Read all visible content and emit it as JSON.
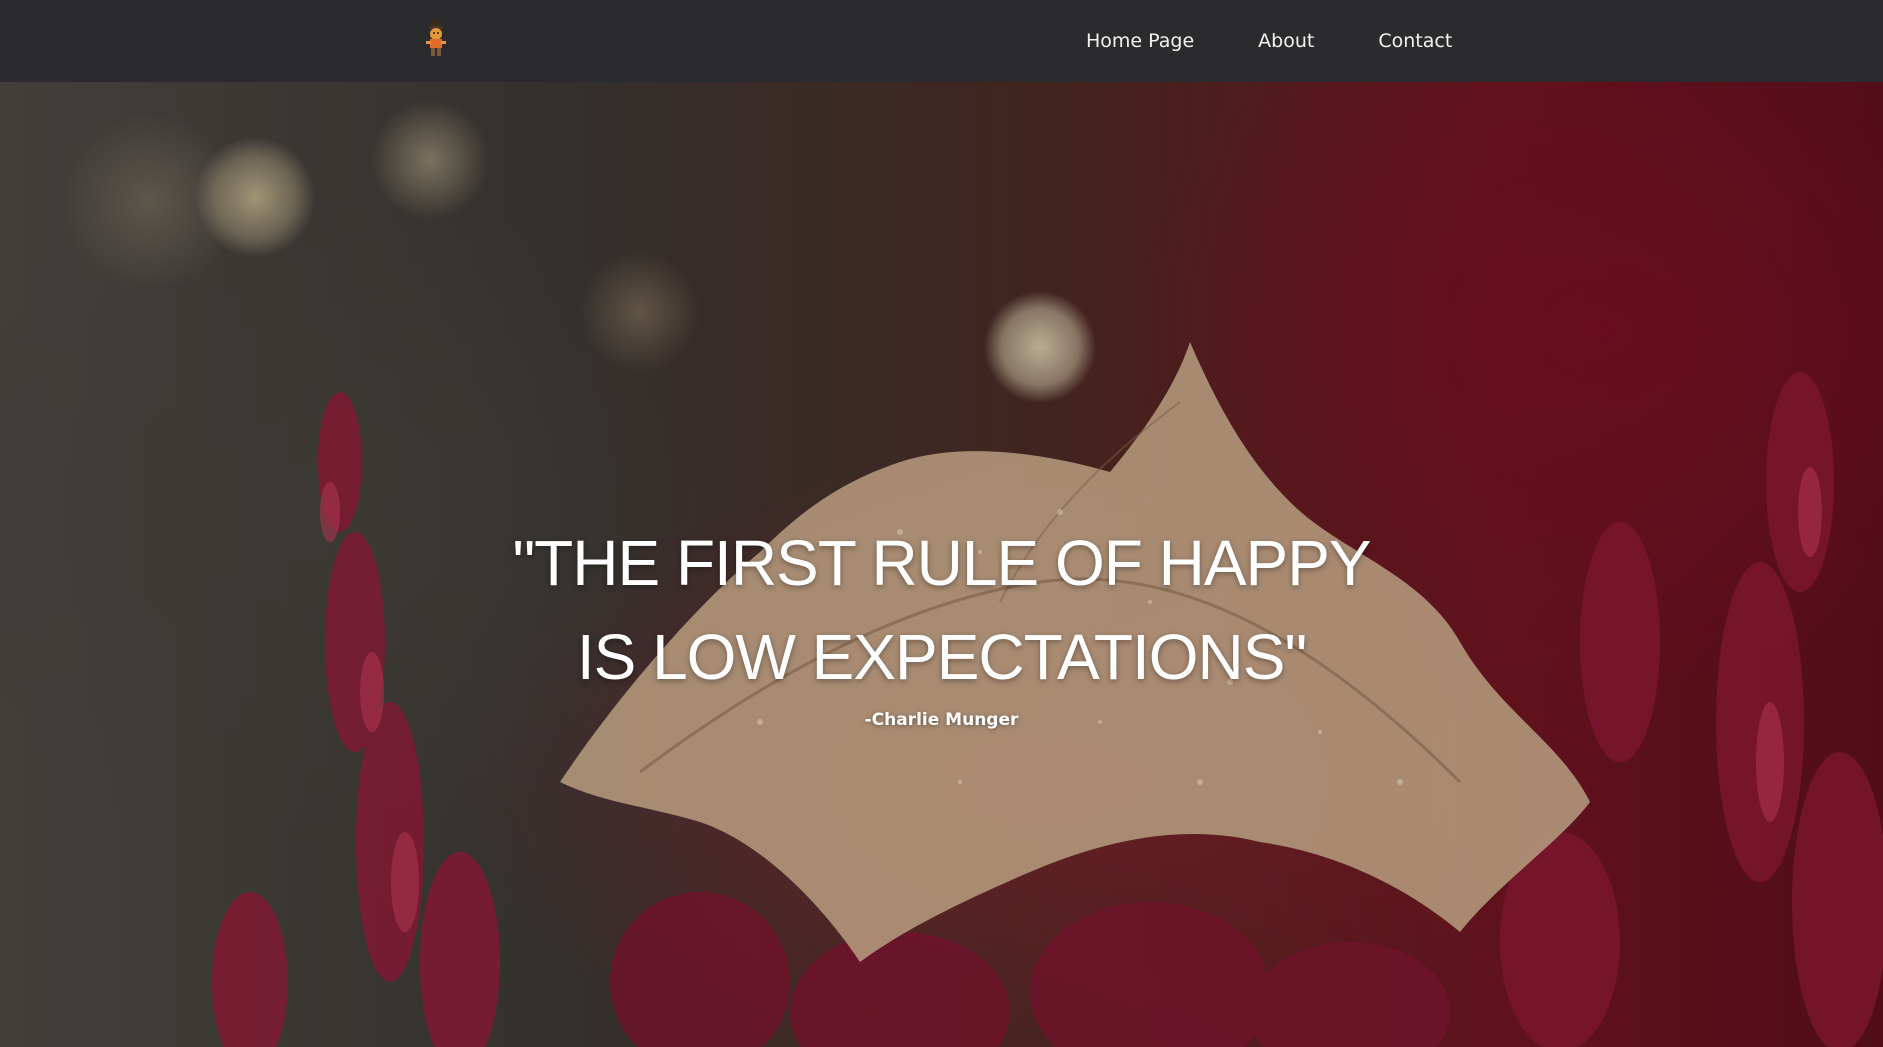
{
  "navbar": {
    "logo_icon": "scarecrow-mascot-icon",
    "links": [
      {
        "label": "Home Page"
      },
      {
        "label": "About"
      },
      {
        "label": "Contact"
      }
    ]
  },
  "hero": {
    "background": "autumn-leaf-heather-photo",
    "quote": "\"THE FIRST RULE OF HAPPY IS LOW EXPECTATIONS\"",
    "author": "-Charlie Munger"
  },
  "colors": {
    "navbar_bg": "#2b2b2d",
    "text": "#ffffff",
    "accent_dark_red": "#6e1520",
    "leaf_tan": "#d8b897"
  }
}
